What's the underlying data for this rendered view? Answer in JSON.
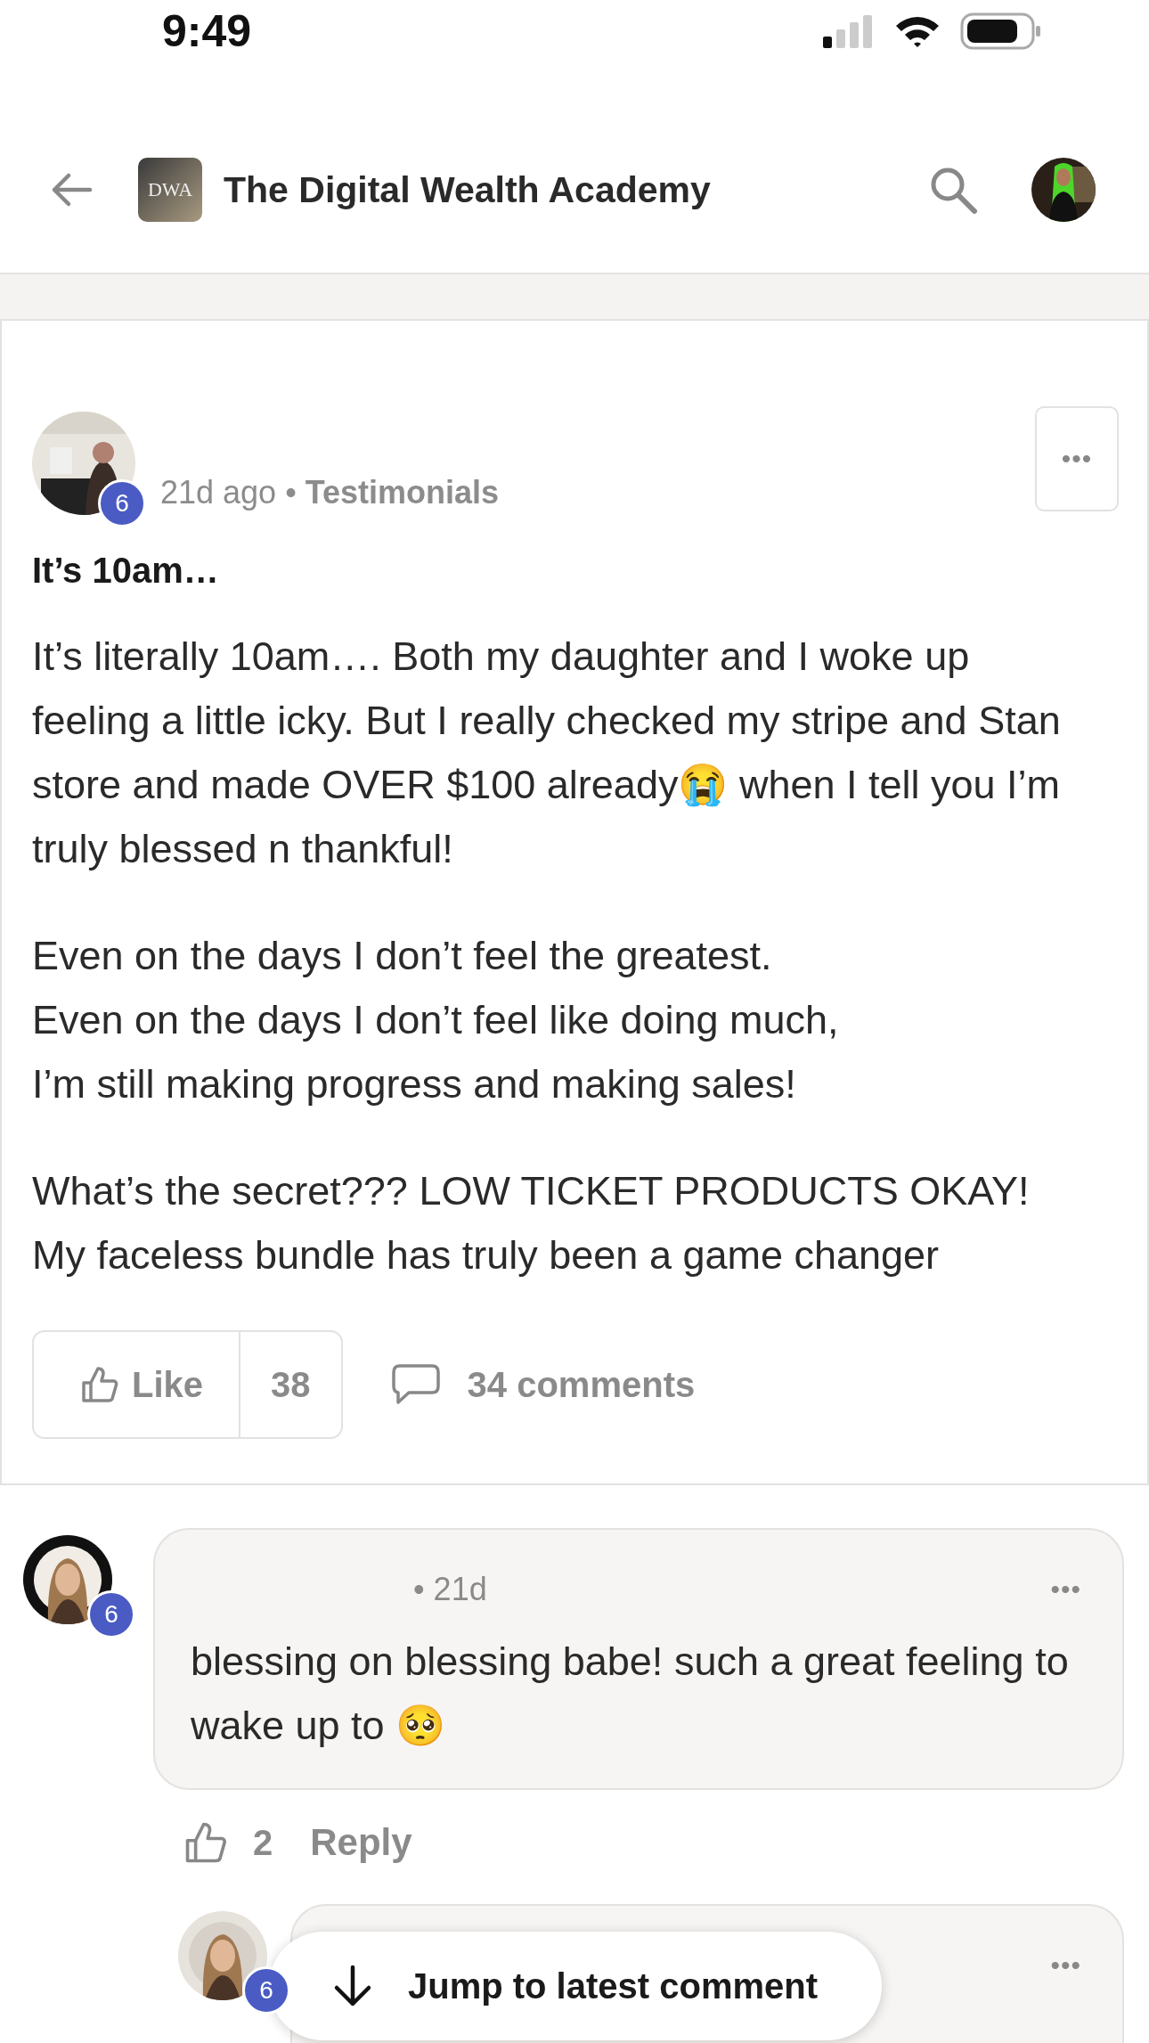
{
  "status_bar": {
    "time": "9:49"
  },
  "header": {
    "logo_text": "DWA",
    "title": "The Digital Wealth Academy"
  },
  "post": {
    "level_badge": "6",
    "time": "21d ago",
    "separator": "•",
    "category": "Testimonials",
    "more": "•••",
    "title": "It’s 10am…",
    "paragraphs": [
      [
        "It’s literally 10am…. Both my daughter and I woke up feeling a little icky. But I really checked my stripe and Stan store and made OVER $100 already😭 when I tell you I’m truly blessed n thankful!"
      ],
      [
        "Even on the days I don’t feel the greatest.",
        "Even on the days I don’t feel like doing much,",
        "I’m still making progress and making sales!"
      ],
      [
        "What’s the secret??? LOW TICKET PRODUCTS OKAY! My faceless bundle has truly been a game changer"
      ]
    ],
    "like_label": "Like",
    "like_count": "38",
    "comments": "34 comments"
  },
  "comments": [
    {
      "level_badge": "6",
      "time": "• 21d",
      "more": "•••",
      "text": "blessing on blessing babe! such a great feeling to wake up to 🥺",
      "like_count": "2",
      "reply": "Reply"
    },
    {
      "level_badge": "6",
      "more": "•••"
    }
  ],
  "jump_button": "Jump to latest comment"
}
